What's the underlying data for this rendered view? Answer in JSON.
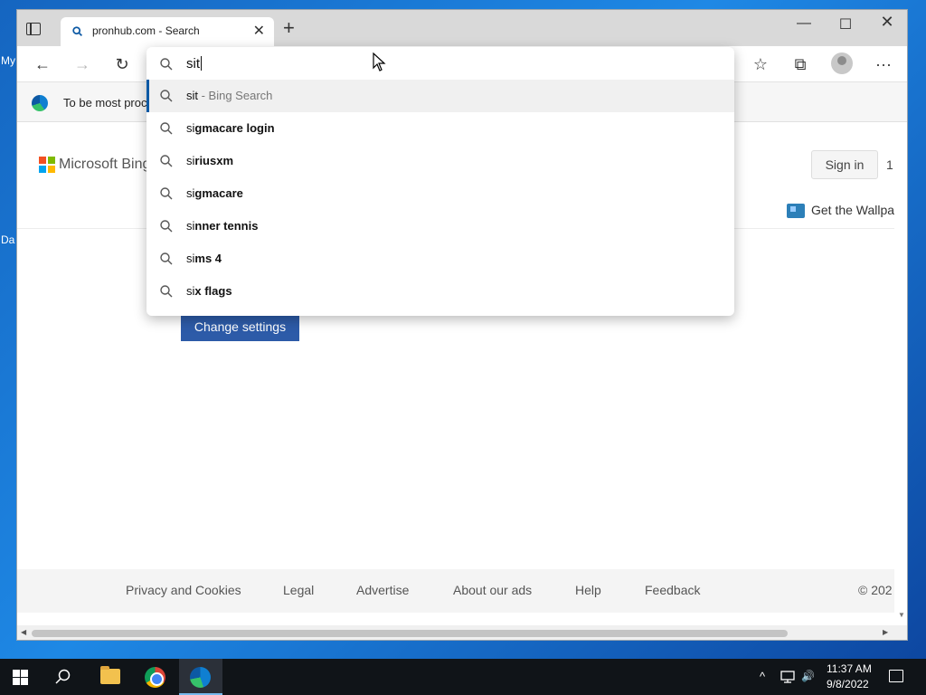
{
  "desktop": {
    "labels": [
      "My",
      "Da"
    ]
  },
  "browser": {
    "tab": {
      "title": "pronhub.com - Search",
      "favicon": "search-icon",
      "close": "✕"
    },
    "new_tab": "+",
    "window_controls": {
      "minimize": "—",
      "maximize": "☐",
      "close": "✕"
    },
    "toolbar": {
      "back": "←",
      "forward": "→",
      "refresh": "↻",
      "favorites": "☆",
      "collections": "⧉",
      "more": "···"
    },
    "infobar_text": "To be most proc",
    "omnibox": {
      "value": "sit"
    },
    "suggestions": [
      {
        "prefix": "sit",
        "rest": "",
        "hint": " - Bing Search",
        "active": true
      },
      {
        "prefix": "si",
        "rest": "gmacare login",
        "hint": ""
      },
      {
        "prefix": "si",
        "rest": "riusxm",
        "hint": ""
      },
      {
        "prefix": "si",
        "rest": "gmacare",
        "hint": ""
      },
      {
        "prefix": "si",
        "rest": "nner tennis",
        "hint": ""
      },
      {
        "prefix": "si",
        "rest": "ms 4",
        "hint": ""
      },
      {
        "prefix": "si",
        "rest": "x flags",
        "hint": ""
      }
    ]
  },
  "page": {
    "brand": "Microsoft Bing",
    "sign_in": "Sign in",
    "sign_in_count": "1",
    "wallpaper": "Get the Wallpa",
    "change_settings": "Change settings",
    "footer": {
      "links": [
        "Privacy and Cookies",
        "Legal",
        "Advertise",
        "About our ads",
        "Help",
        "Feedback"
      ],
      "copyright": "© 202"
    }
  },
  "taskbar": {
    "tray_chevron": "^",
    "volume": "🔊",
    "clock": {
      "time": "11:37 AM",
      "date": "9/8/2022"
    }
  },
  "colors": {
    "accent": "#0c59a4",
    "button_blue": "#2d5ba8",
    "taskbar": "#101418"
  }
}
